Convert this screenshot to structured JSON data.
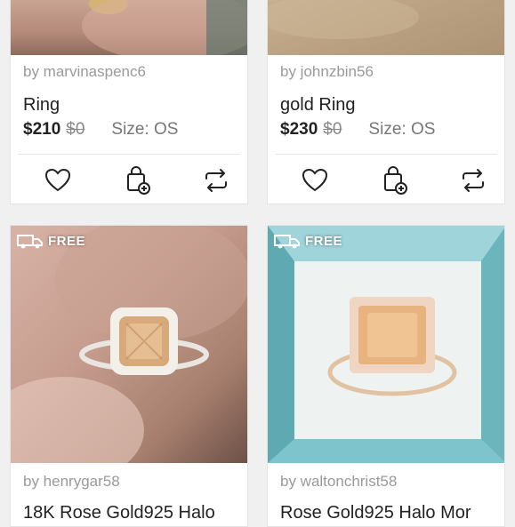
{
  "colors": {
    "page_bg": "#f0f0f0",
    "card_bg": "#ffffff",
    "muted_text": "#9a9a9a",
    "strike_text": "#888888"
  },
  "listings": [
    {
      "seller": "by marvinaspenc6",
      "title": "Ring",
      "price": "$210",
      "original_price": "$0",
      "size": "Size: OS",
      "image_icon": "ring-photo"
    },
    {
      "seller": "by johnzbin56",
      "title": "gold Ring",
      "price": "$230",
      "original_price": "$0",
      "size": "Size: OS",
      "image_icon": "ring-photo"
    },
    {
      "badge": "FREE",
      "seller": "by henrygar58",
      "title": "18K Rose Gold925 Halo",
      "image_icon": "champagne-ring-photo"
    },
    {
      "badge": "FREE",
      "seller": "by waltonchrist58",
      "title": "Rose Gold925 Halo Mor",
      "image_icon": "champagne-ring-in-box-photo"
    }
  ],
  "actions": {
    "like_icon": "heart-icon",
    "bundle_icon": "bag-add-icon",
    "share_icon": "share-icon"
  }
}
